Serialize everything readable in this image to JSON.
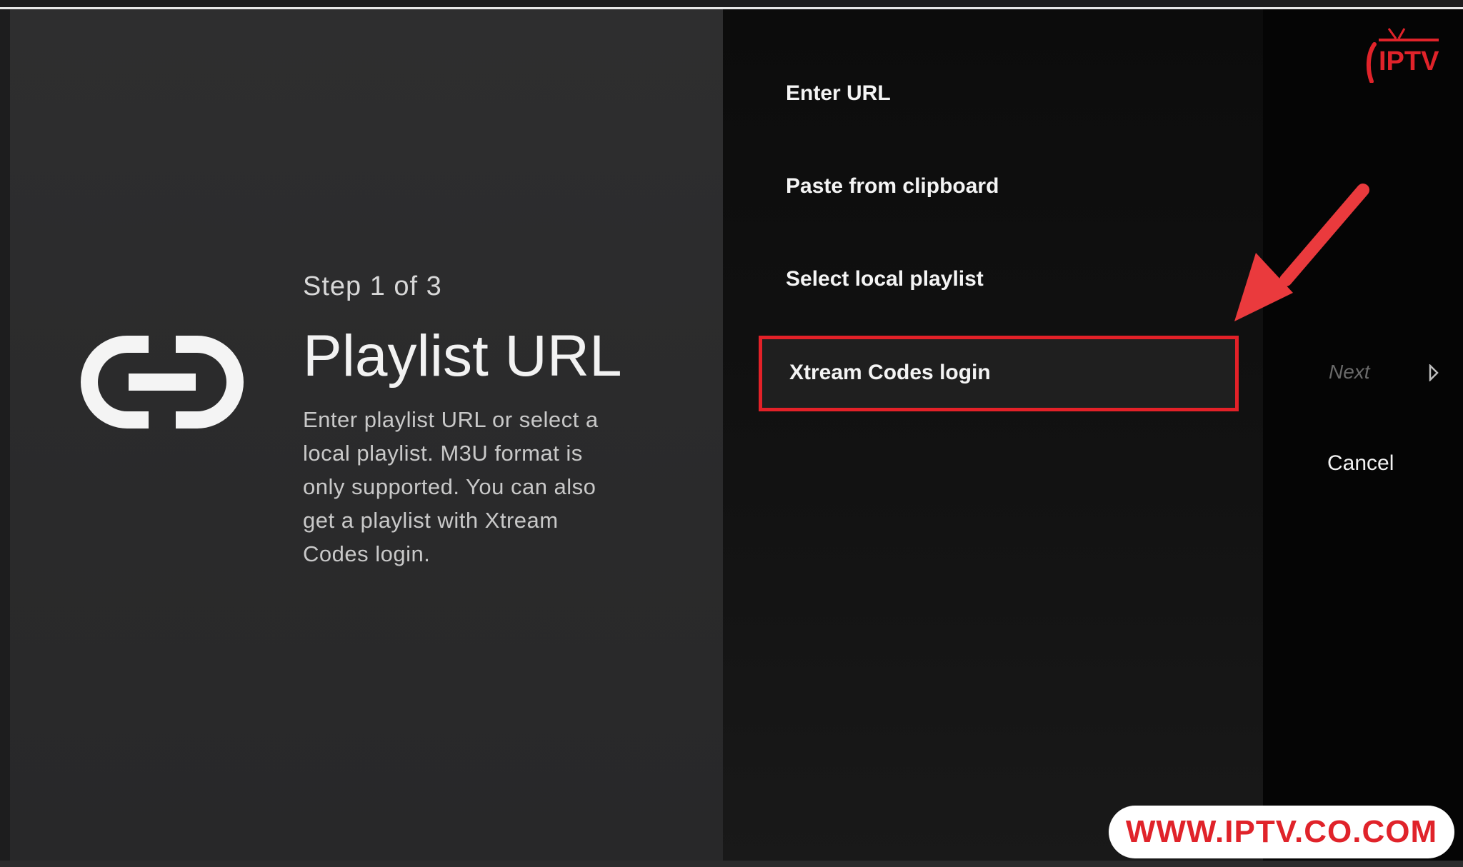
{
  "step": {
    "label": "Step 1 of 3",
    "title": "Playlist URL",
    "description": "Enter playlist URL or select a local playlist. M3U format is only supported. You can also get a playlist with Xtream Codes login."
  },
  "menu": {
    "items": [
      {
        "label": "Enter URL"
      },
      {
        "label": "Paste from clipboard"
      },
      {
        "label": "Select local playlist"
      },
      {
        "label": "Xtream Codes login"
      }
    ]
  },
  "actions": {
    "next_label": "Next",
    "cancel_label": "Cancel"
  },
  "branding": {
    "logo_text": "IPTV",
    "watermark": "WWW.IPTV.CO.COM"
  },
  "colors": {
    "highlight": "#e32128",
    "brand": "#e0232a",
    "background": "#2a2a2b"
  },
  "icons": {
    "main": "link-icon",
    "next": "chevron-right-icon",
    "annotation": "pointer-arrow-icon"
  }
}
